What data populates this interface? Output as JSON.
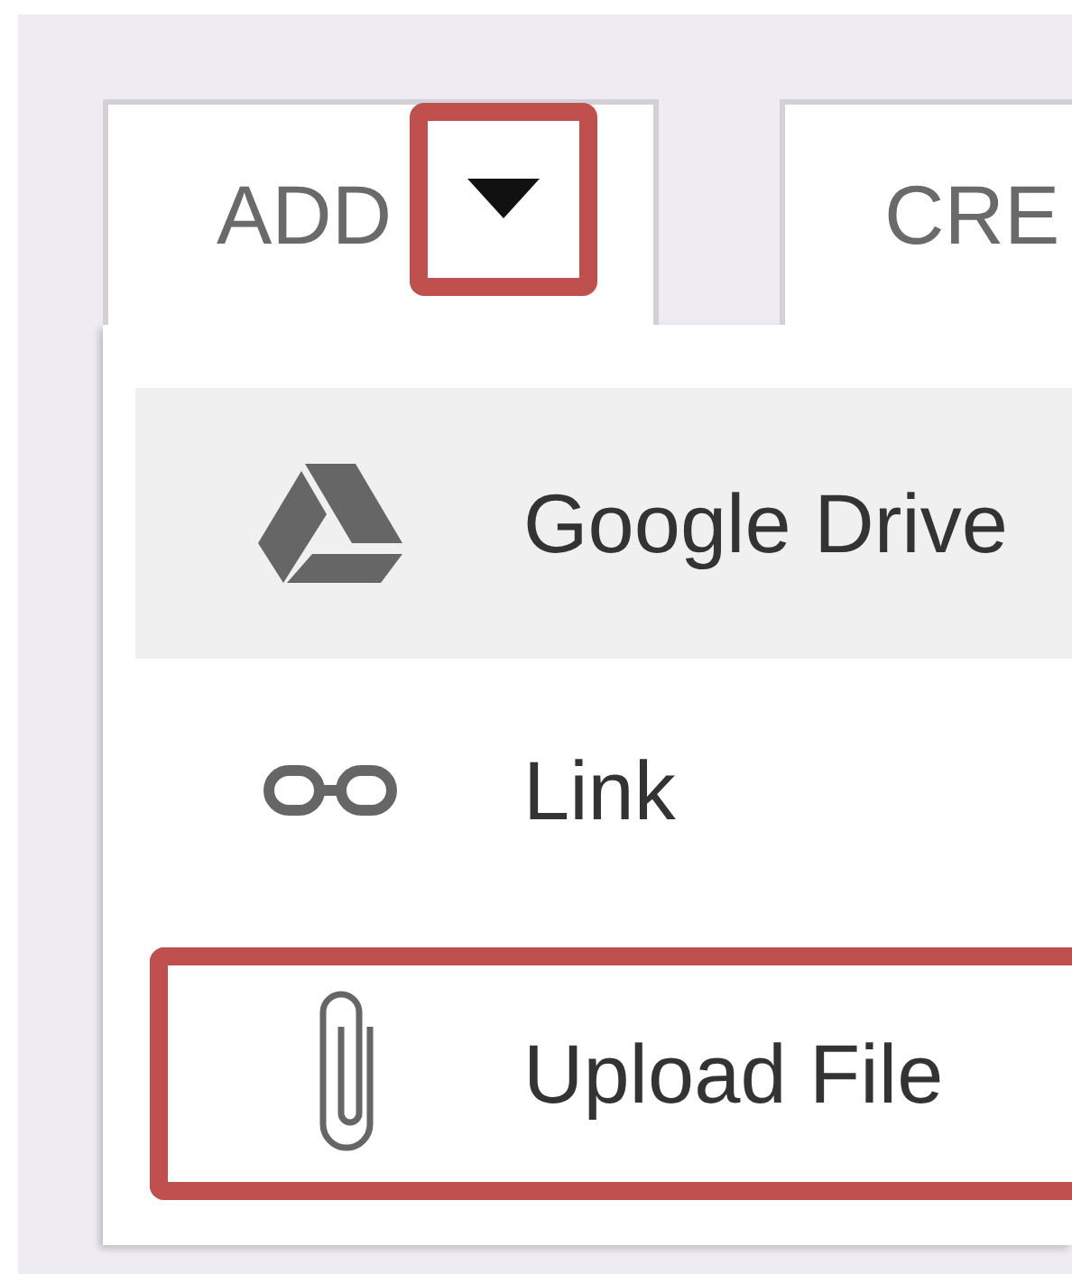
{
  "toolbar": {
    "buttons": [
      {
        "label": "ADD",
        "kind": "dropdown",
        "caret_highlighted": true
      },
      {
        "label": "CRE",
        "kind": "plain"
      }
    ]
  },
  "menu": {
    "items": [
      {
        "label": "Google Drive",
        "kind": "drive",
        "hovered": true,
        "highlighted": false
      },
      {
        "label": "Link",
        "kind": "link",
        "hovered": false,
        "highlighted": false
      },
      {
        "label": "Upload File",
        "kind": "upload",
        "hovered": false,
        "highlighted": true
      }
    ]
  }
}
